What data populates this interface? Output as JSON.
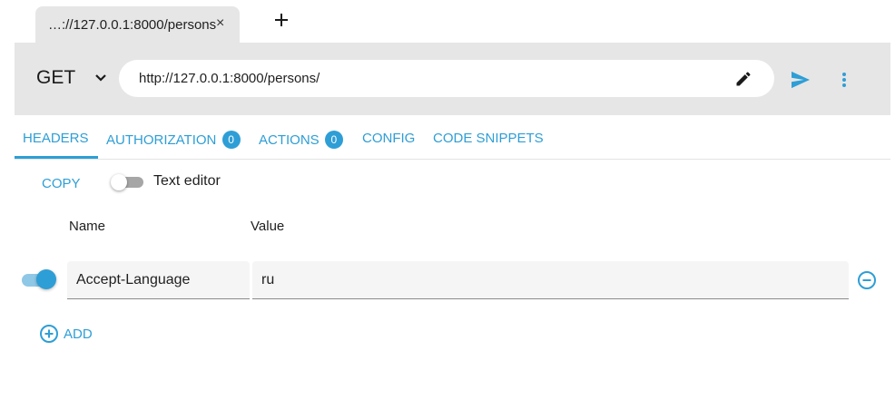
{
  "tab": {
    "title": "…://127.0.0.1:8000/persons",
    "close_glyph": "×",
    "new_tab_icon": "plus-icon"
  },
  "request": {
    "method": "GET",
    "url": "http://127.0.0.1:8000/persons/",
    "icons": [
      "chevron-down-icon",
      "edit-icon",
      "send-icon",
      "more-vert-icon"
    ]
  },
  "request_tabs": [
    {
      "label": "HEADERS",
      "active": true
    },
    {
      "label": "AUTHORIZATION",
      "badge": "0"
    },
    {
      "label": "ACTIONS",
      "badge": "0"
    },
    {
      "label": "CONFIG"
    },
    {
      "label": "CODE SNIPPETS"
    }
  ],
  "editor": {
    "copy_label": "COPY",
    "text_editor_label": "Text editor",
    "text_editor_enabled": false,
    "columns": {
      "name": "Name",
      "value": "Value"
    },
    "headers": [
      {
        "enabled": true,
        "name": "Accept-Language",
        "value": "ru"
      }
    ],
    "add_label": "ADD"
  },
  "colors": {
    "accent": "#2e9ed6",
    "bar_background": "#e6e6e6"
  }
}
